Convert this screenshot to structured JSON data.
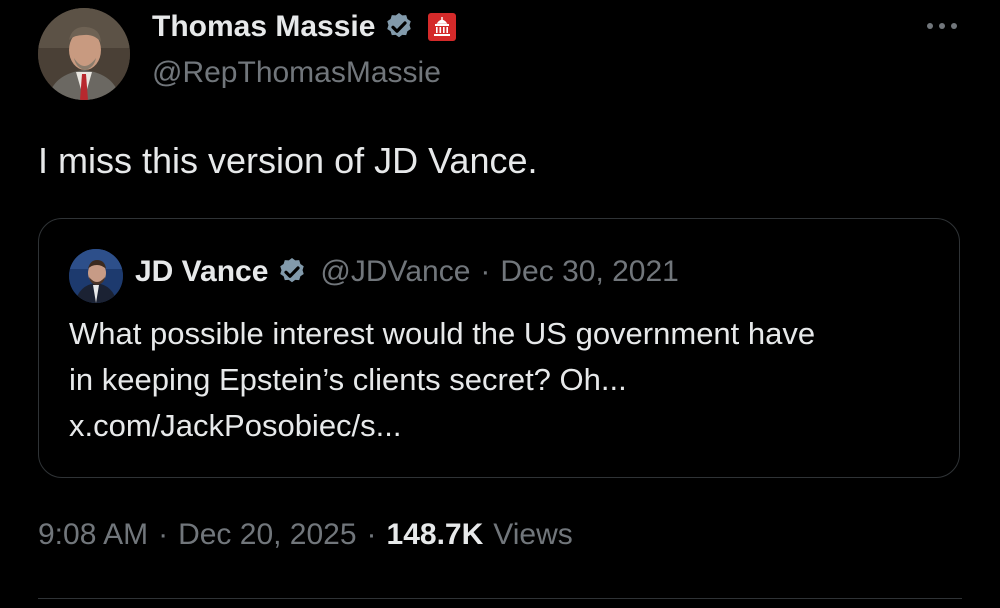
{
  "tweet": {
    "author_name": "Thomas Massie",
    "author_handle": "@RepThomasMassie",
    "avatar_icon": "person-avatar",
    "verified_icon": "verified-badge-icon",
    "gov_badge_icon": "capitol-building-icon",
    "more_icon": "more-options-icon",
    "text": "I miss this version of JD Vance.",
    "time": "9:08 AM",
    "separator": "·",
    "date": "Dec 20, 2025",
    "views_count": "148.7K",
    "views_label": "Views"
  },
  "quoted_tweet": {
    "author_name": "JD Vance",
    "author_handle": "@JDVance",
    "separator": "·",
    "date": "Dec 30, 2021",
    "text_line1": "What possible interest would the US government have",
    "text_line2": "in keeping Epstein’s clients secret? Oh...",
    "link_text": "x.com/JackPosobiec/s..."
  },
  "colors": {
    "background": "#000000",
    "primary_text": "#e7e9ea",
    "secondary_text": "#71767b",
    "verified_blue": "#829aab",
    "gov_badge_red": "#d42a2a",
    "border": "#2f3336"
  }
}
